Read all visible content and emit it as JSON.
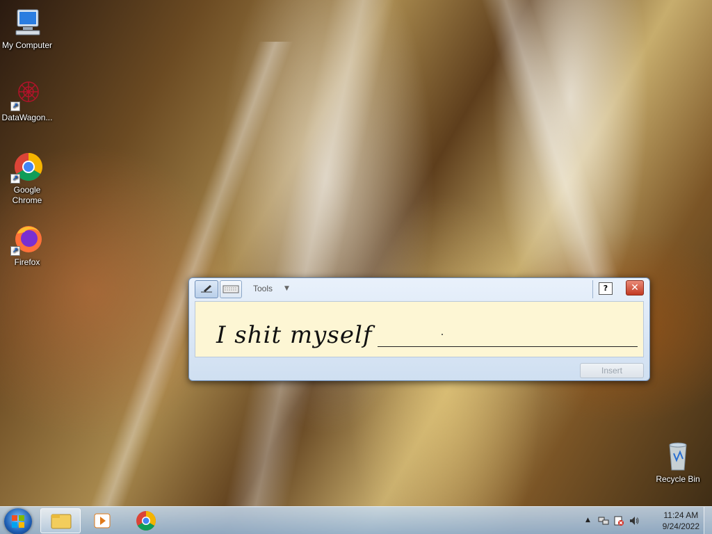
{
  "desktop": {
    "icons": [
      {
        "label": "My Computer",
        "icon": "computer-icon"
      },
      {
        "label": "DataWagon...",
        "icon": "datawagon-icon"
      },
      {
        "label": "Google Chrome",
        "icon": "chrome-icon"
      },
      {
        "label": "Firefox",
        "icon": "firefox-icon"
      },
      {
        "label": "Recycle Bin",
        "icon": "recycle-bin-icon"
      }
    ]
  },
  "input_panel": {
    "tools_label": "Tools",
    "handwriting": "I shit myself",
    "insert_label": "Insert",
    "close_glyph": "✕",
    "help_glyph": "?"
  },
  "taskbar": {
    "pinned": [
      "windows-explorer-icon",
      "media-player-icon",
      "chrome-icon"
    ],
    "clock_time": "11:24 AM",
    "clock_date": "9/24/2022",
    "tray_arrow": "▲"
  }
}
